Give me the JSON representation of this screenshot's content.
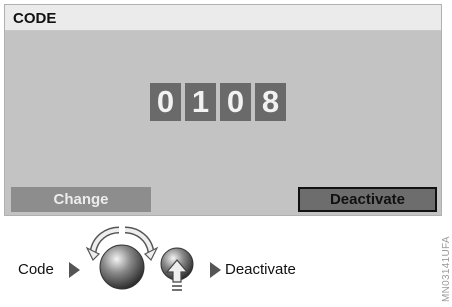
{
  "screen": {
    "title": "CODE",
    "digits": [
      "0",
      "1",
      "0",
      "8"
    ],
    "buttons": {
      "change": "Change",
      "deactivate": "Deactivate"
    }
  },
  "instructions": {
    "code_label": "Code",
    "deactivate_label": "Deactivate"
  },
  "side_code": "MN03141UFA",
  "icons": [
    "turn-controller-icon",
    "press-controller-icon",
    "arrow-right-icon"
  ],
  "colors": {
    "screen_bg": "#c3c3c3",
    "title_bar_bg": "#ebebeb",
    "digit_bg": "#6a6a6a",
    "change_btn_bg": "#8d8d8d",
    "deactivate_btn_bg": "#6d6d6d"
  }
}
